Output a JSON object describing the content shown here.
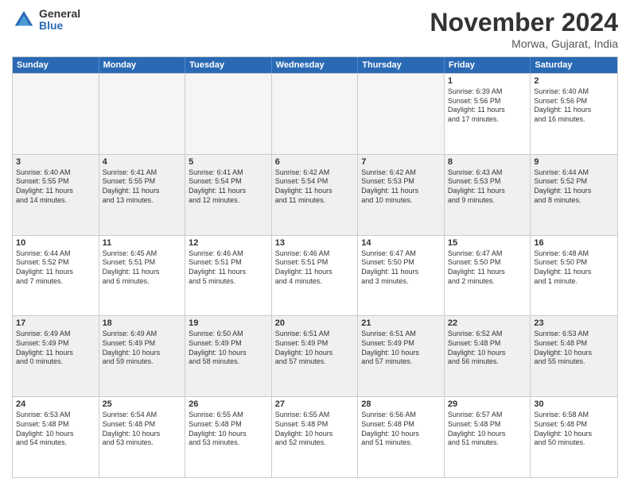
{
  "logo": {
    "general": "General",
    "blue": "Blue"
  },
  "title": "November 2024",
  "location": "Morwa, Gujarat, India",
  "header_days": [
    "Sunday",
    "Monday",
    "Tuesday",
    "Wednesday",
    "Thursday",
    "Friday",
    "Saturday"
  ],
  "weeks": [
    {
      "alt": false,
      "cells": [
        {
          "day": "",
          "empty": true,
          "lines": []
        },
        {
          "day": "",
          "empty": true,
          "lines": []
        },
        {
          "day": "",
          "empty": true,
          "lines": []
        },
        {
          "day": "",
          "empty": true,
          "lines": []
        },
        {
          "day": "",
          "empty": true,
          "lines": []
        },
        {
          "day": "1",
          "empty": false,
          "lines": [
            "Sunrise: 6:39 AM",
            "Sunset: 5:56 PM",
            "Daylight: 11 hours",
            "and 17 minutes."
          ]
        },
        {
          "day": "2",
          "empty": false,
          "lines": [
            "Sunrise: 6:40 AM",
            "Sunset: 5:56 PM",
            "Daylight: 11 hours",
            "and 16 minutes."
          ]
        }
      ]
    },
    {
      "alt": true,
      "cells": [
        {
          "day": "3",
          "empty": false,
          "lines": [
            "Sunrise: 6:40 AM",
            "Sunset: 5:55 PM",
            "Daylight: 11 hours",
            "and 14 minutes."
          ]
        },
        {
          "day": "4",
          "empty": false,
          "lines": [
            "Sunrise: 6:41 AM",
            "Sunset: 5:55 PM",
            "Daylight: 11 hours",
            "and 13 minutes."
          ]
        },
        {
          "day": "5",
          "empty": false,
          "lines": [
            "Sunrise: 6:41 AM",
            "Sunset: 5:54 PM",
            "Daylight: 11 hours",
            "and 12 minutes."
          ]
        },
        {
          "day": "6",
          "empty": false,
          "lines": [
            "Sunrise: 6:42 AM",
            "Sunset: 5:54 PM",
            "Daylight: 11 hours",
            "and 11 minutes."
          ]
        },
        {
          "day": "7",
          "empty": false,
          "lines": [
            "Sunrise: 6:42 AM",
            "Sunset: 5:53 PM",
            "Daylight: 11 hours",
            "and 10 minutes."
          ]
        },
        {
          "day": "8",
          "empty": false,
          "lines": [
            "Sunrise: 6:43 AM",
            "Sunset: 5:53 PM",
            "Daylight: 11 hours",
            "and 9 minutes."
          ]
        },
        {
          "day": "9",
          "empty": false,
          "lines": [
            "Sunrise: 6:44 AM",
            "Sunset: 5:52 PM",
            "Daylight: 11 hours",
            "and 8 minutes."
          ]
        }
      ]
    },
    {
      "alt": false,
      "cells": [
        {
          "day": "10",
          "empty": false,
          "lines": [
            "Sunrise: 6:44 AM",
            "Sunset: 5:52 PM",
            "Daylight: 11 hours",
            "and 7 minutes."
          ]
        },
        {
          "day": "11",
          "empty": false,
          "lines": [
            "Sunrise: 6:45 AM",
            "Sunset: 5:51 PM",
            "Daylight: 11 hours",
            "and 6 minutes."
          ]
        },
        {
          "day": "12",
          "empty": false,
          "lines": [
            "Sunrise: 6:46 AM",
            "Sunset: 5:51 PM",
            "Daylight: 11 hours",
            "and 5 minutes."
          ]
        },
        {
          "day": "13",
          "empty": false,
          "lines": [
            "Sunrise: 6:46 AM",
            "Sunset: 5:51 PM",
            "Daylight: 11 hours",
            "and 4 minutes."
          ]
        },
        {
          "day": "14",
          "empty": false,
          "lines": [
            "Sunrise: 6:47 AM",
            "Sunset: 5:50 PM",
            "Daylight: 11 hours",
            "and 3 minutes."
          ]
        },
        {
          "day": "15",
          "empty": false,
          "lines": [
            "Sunrise: 6:47 AM",
            "Sunset: 5:50 PM",
            "Daylight: 11 hours",
            "and 2 minutes."
          ]
        },
        {
          "day": "16",
          "empty": false,
          "lines": [
            "Sunrise: 6:48 AM",
            "Sunset: 5:50 PM",
            "Daylight: 11 hours",
            "and 1 minute."
          ]
        }
      ]
    },
    {
      "alt": true,
      "cells": [
        {
          "day": "17",
          "empty": false,
          "lines": [
            "Sunrise: 6:49 AM",
            "Sunset: 5:49 PM",
            "Daylight: 11 hours",
            "and 0 minutes."
          ]
        },
        {
          "day": "18",
          "empty": false,
          "lines": [
            "Sunrise: 6:49 AM",
            "Sunset: 5:49 PM",
            "Daylight: 10 hours",
            "and 59 minutes."
          ]
        },
        {
          "day": "19",
          "empty": false,
          "lines": [
            "Sunrise: 6:50 AM",
            "Sunset: 5:49 PM",
            "Daylight: 10 hours",
            "and 58 minutes."
          ]
        },
        {
          "day": "20",
          "empty": false,
          "lines": [
            "Sunrise: 6:51 AM",
            "Sunset: 5:49 PM",
            "Daylight: 10 hours",
            "and 57 minutes."
          ]
        },
        {
          "day": "21",
          "empty": false,
          "lines": [
            "Sunrise: 6:51 AM",
            "Sunset: 5:49 PM",
            "Daylight: 10 hours",
            "and 57 minutes."
          ]
        },
        {
          "day": "22",
          "empty": false,
          "lines": [
            "Sunrise: 6:52 AM",
            "Sunset: 5:48 PM",
            "Daylight: 10 hours",
            "and 56 minutes."
          ]
        },
        {
          "day": "23",
          "empty": false,
          "lines": [
            "Sunrise: 6:53 AM",
            "Sunset: 5:48 PM",
            "Daylight: 10 hours",
            "and 55 minutes."
          ]
        }
      ]
    },
    {
      "alt": false,
      "cells": [
        {
          "day": "24",
          "empty": false,
          "lines": [
            "Sunrise: 6:53 AM",
            "Sunset: 5:48 PM",
            "Daylight: 10 hours",
            "and 54 minutes."
          ]
        },
        {
          "day": "25",
          "empty": false,
          "lines": [
            "Sunrise: 6:54 AM",
            "Sunset: 5:48 PM",
            "Daylight: 10 hours",
            "and 53 minutes."
          ]
        },
        {
          "day": "26",
          "empty": false,
          "lines": [
            "Sunrise: 6:55 AM",
            "Sunset: 5:48 PM",
            "Daylight: 10 hours",
            "and 53 minutes."
          ]
        },
        {
          "day": "27",
          "empty": false,
          "lines": [
            "Sunrise: 6:55 AM",
            "Sunset: 5:48 PM",
            "Daylight: 10 hours",
            "and 52 minutes."
          ]
        },
        {
          "day": "28",
          "empty": false,
          "lines": [
            "Sunrise: 6:56 AM",
            "Sunset: 5:48 PM",
            "Daylight: 10 hours",
            "and 51 minutes."
          ]
        },
        {
          "day": "29",
          "empty": false,
          "lines": [
            "Sunrise: 6:57 AM",
            "Sunset: 5:48 PM",
            "Daylight: 10 hours",
            "and 51 minutes."
          ]
        },
        {
          "day": "30",
          "empty": false,
          "lines": [
            "Sunrise: 6:58 AM",
            "Sunset: 5:48 PM",
            "Daylight: 10 hours",
            "and 50 minutes."
          ]
        }
      ]
    }
  ]
}
